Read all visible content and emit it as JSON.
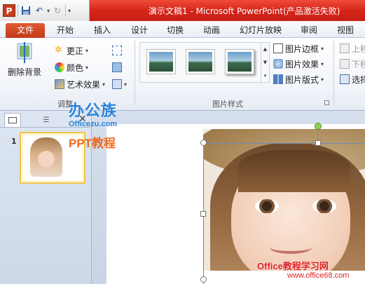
{
  "window": {
    "title": "演示文稿1 - Microsoft PowerPoint(产品激活失败)"
  },
  "qat": {
    "logo": "P",
    "save_icon": "save-icon",
    "undo_icon": "undo-icon",
    "redo_icon": "redo-icon"
  },
  "tabs": [
    "文件",
    "开始",
    "插入",
    "设计",
    "切换",
    "动画",
    "幻灯片放映",
    "审阅",
    "视图"
  ],
  "ribbon": {
    "adjust": {
      "remove_bg": "删除背景",
      "corrections": "更正",
      "color": "颜色",
      "artistic": "艺术效果",
      "label": "调整"
    },
    "styles": {
      "border": "图片边框",
      "effects": "图片效果",
      "layout": "图片版式",
      "label": "图片样式"
    },
    "arrange": {
      "forward": "上移",
      "backward": "下移",
      "selection": "选择"
    }
  },
  "slides_panel": {
    "slide_number": "1"
  },
  "watermarks": {
    "brand_cn": "办公族",
    "brand_url": "Officezu.com",
    "brand_sub": "PPT教程",
    "site_cn": "Office教程学习网",
    "site_url": "www.office68.com"
  },
  "colors": {
    "title_bar": "#d6251a",
    "file_tab": "#c0391b",
    "accent": "#2a83d8"
  }
}
